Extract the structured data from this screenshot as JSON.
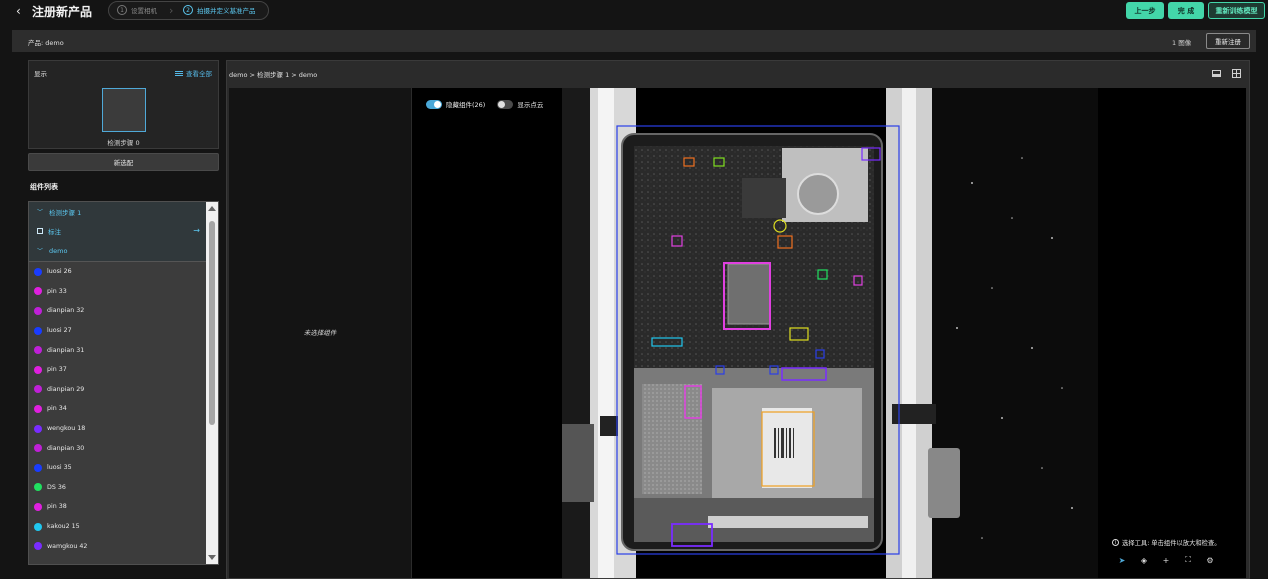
{
  "header": {
    "title": "注册新产品",
    "steps": [
      {
        "num": "1",
        "label": "设置相机"
      },
      {
        "num": "2",
        "label": "拍摄并定义基准产品"
      }
    ],
    "buttons": {
      "prev": "上一步",
      "done": "完 成",
      "retrain": "重新训练模型"
    }
  },
  "product_bar": {
    "product": "产品: demo",
    "image_count": "1 图像",
    "reregister": "重新注册"
  },
  "left": {
    "display_title": "显示",
    "view_all": "查看全部",
    "thumb_label": "检测步骤 0",
    "new_button": "新选配",
    "component_list_title": "组件列表",
    "tree": {
      "step": "检测步骤 1",
      "mark": "标注",
      "group": "demo"
    },
    "items": [
      {
        "name": "luosi 26",
        "color": "#1a3cff"
      },
      {
        "name": "pin 33",
        "color": "#e020e0"
      },
      {
        "name": "dianpian 32",
        "color": "#c020d8"
      },
      {
        "name": "luosi 27",
        "color": "#1a3cff"
      },
      {
        "name": "dianpian 31",
        "color": "#c020d8"
      },
      {
        "name": "pin 37",
        "color": "#e020e0"
      },
      {
        "name": "dianpian 29",
        "color": "#c020d8"
      },
      {
        "name": "pin 34",
        "color": "#e020e0"
      },
      {
        "name": "wengkou 18",
        "color": "#7a2cff"
      },
      {
        "name": "dianpian 30",
        "color": "#c020d8"
      },
      {
        "name": "luosi 35",
        "color": "#1a3cff"
      },
      {
        "name": "DS 36",
        "color": "#20e060"
      },
      {
        "name": "pin 38",
        "color": "#e020e0"
      },
      {
        "name": "kakou2 15",
        "color": "#20c8f0"
      },
      {
        "name": "wamgkou 42",
        "color": "#7a2cff"
      }
    ]
  },
  "main": {
    "breadcrumb": "demo > 检测步骤 1 > demo",
    "unselected": "未选择组件",
    "toggle_hidden": "隐藏组件(26)",
    "toggle_cloud": "显示点云",
    "tool_hint": "选择工具: 单击组件以放大和检查。",
    "tools": [
      "pointer-icon",
      "eraser-icon",
      "plus-icon",
      "fit-icon",
      "settings-icon"
    ]
  }
}
